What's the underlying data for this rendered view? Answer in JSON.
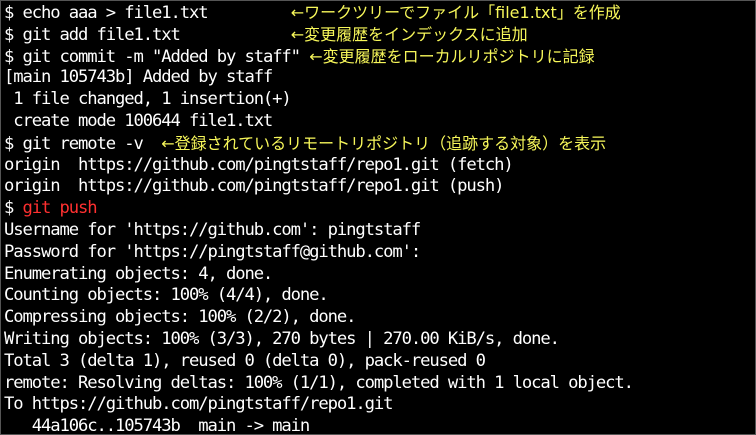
{
  "colors": {
    "background": "#000000",
    "text": "#ffffff",
    "annotation": "#f7f75a",
    "highlight_command": "#ff3030"
  },
  "terminal": {
    "lines": [
      {
        "prompt": "$ ",
        "command": "echo aaa > file1.txt",
        "gap": "         ",
        "note": "←ワークツリーでファイル「file1.txt」を作成"
      },
      {
        "prompt": "$ ",
        "command": "git add file1.txt",
        "gap": "            ",
        "note": "←変更履歴をインデックスに追加"
      },
      {
        "prompt": "$ ",
        "command": "git commit -m \"Added by staff\"",
        "gap": " ",
        "note": "←変更履歴をローカルリポジトリに記録"
      },
      {
        "text": "[main 105743b] Added by staff"
      },
      {
        "text": " 1 file changed, 1 insertion(+)"
      },
      {
        "text": " create mode 100644 file1.txt"
      },
      {
        "prompt": "$ ",
        "command": "git remote -v",
        "gap": "  ",
        "note": "←登録されているリモートリポジトリ（追跡する対象）を表示"
      },
      {
        "text": "origin  https://github.com/pingtstaff/repo1.git (fetch)"
      },
      {
        "text": "origin  https://github.com/pingtstaff/repo1.git (push)"
      },
      {
        "prompt": "$ ",
        "command_red": "git push"
      },
      {
        "text": "Username for 'https://github.com': pingtstaff"
      },
      {
        "text": "Password for 'https://pingtstaff@github.com':"
      },
      {
        "text": "Enumerating objects: 4, done."
      },
      {
        "text": "Counting objects: 100% (4/4), done."
      },
      {
        "text": "Compressing objects: 100% (2/2), done."
      },
      {
        "text": "Writing objects: 100% (3/3), 270 bytes | 270.00 KiB/s, done."
      },
      {
        "text": "Total 3 (delta 1), reused 0 (delta 0), pack-reused 0"
      },
      {
        "text": "remote: Resolving deltas: 100% (1/1), completed with 1 local object."
      },
      {
        "text": "To https://github.com/pingtstaff/repo1.git"
      },
      {
        "text": "   44a106c..105743b  main -> main"
      }
    ]
  }
}
